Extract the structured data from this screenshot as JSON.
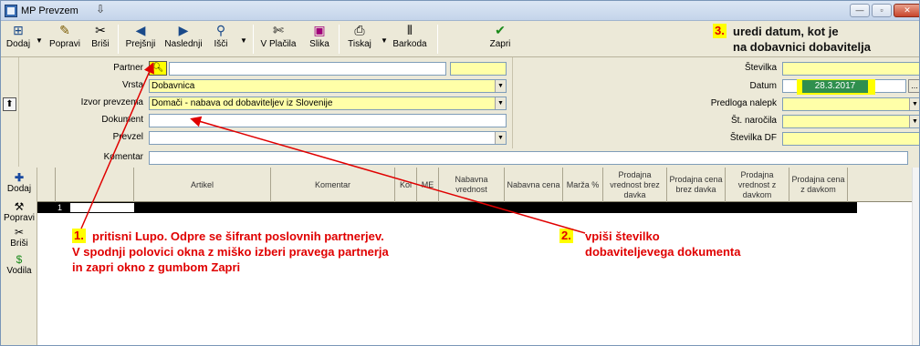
{
  "window": {
    "title": "MP Prevzem",
    "minimize": "—",
    "maximize": "▫",
    "close": "✕"
  },
  "toolbar": {
    "dodaj": "Dodaj",
    "popravi": "Popravi",
    "brisi": "Briši",
    "prejsnji": "Prejšnji",
    "naslednji": "Naslednji",
    "isci": "Išči",
    "v_placila": "V Plačila",
    "slika": "Slika",
    "tiskaj": "Tiskaj",
    "barkoda": "Barkoda",
    "zapri": "Zapri"
  },
  "form": {
    "partner_label": "Partner",
    "partner_value": "",
    "vrsta_label": "Vrsta",
    "vrsta_value": "Dobavnica",
    "izvor_label": "Izvor prevzema",
    "izvor_value": "Domači - nabava od dobaviteljev iz Slovenije",
    "dokument_label": "Dokument",
    "dokument_value": "",
    "prevzel_label": "Prevzel",
    "prevzel_value": "",
    "komentar_label": "Komentar",
    "komentar_value": ""
  },
  "right_form": {
    "stevilka_label": "Številka",
    "datum_label": "Datum",
    "datum_value": "28.3.2017",
    "predloga_label": "Predloga nalepk",
    "st_narocila_label": "Št. naročila",
    "stevilka_df_label": "Številka DF",
    "dots": "..."
  },
  "side_tools": {
    "dodaj": "Dodaj",
    "popravi": "Popravi",
    "brisi": "Briši",
    "vodila": "Vodila"
  },
  "grid": {
    "columns": [
      "Artikel",
      "Komentar",
      "Kol",
      "ME",
      "Nabavna vrednost",
      "Nabavna cena",
      "Marža %",
      "Prodajna vrednost brez davka",
      "Prodajna cena brez davka",
      "Prodajna vrednost z davkom",
      "Prodajna cena z davkom"
    ],
    "row_number": "1"
  },
  "annotations": {
    "a1_num": "1.",
    "a1_line1": "pritisni Lupo. Odpre se šifrant poslovnih partnerjev.",
    "a1_line2": "V spodnji polovici okna z miško izberi pravega partnerja",
    "a1_line3": "in zapri okno z gumbom Zapri",
    "a2_num": "2.",
    "a2_line1": "vpiši številko",
    "a2_line2": "dobaviteljevega dokumenta",
    "a3_num": "3.",
    "a3_line1": "uredi datum, kot je",
    "a3_line2": "na dobavnici dobavitelja"
  },
  "colors": {
    "highlight": "#ffff00",
    "annotation": "#e00000",
    "field_yellow": "#ffffa8",
    "date_bg": "#2f8f4e"
  }
}
